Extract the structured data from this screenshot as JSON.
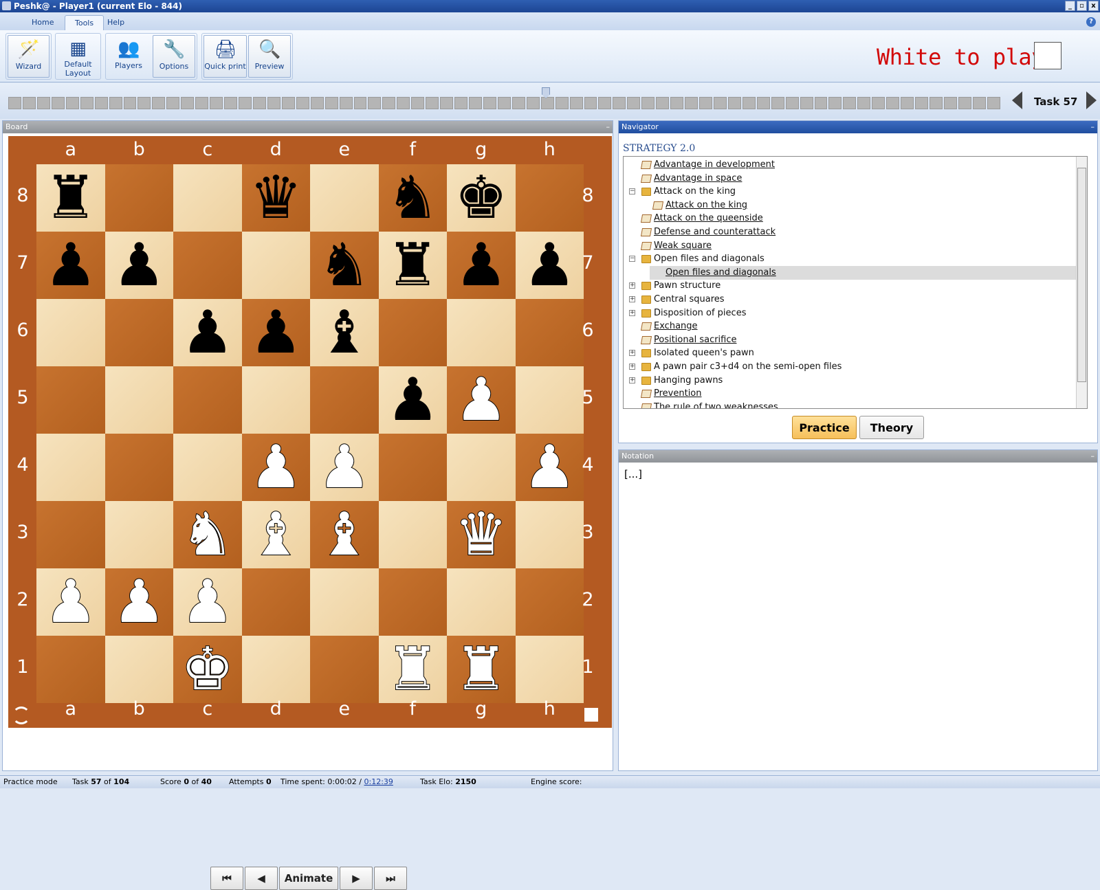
{
  "window": {
    "title": "Peshk@ - Player1 (current Elo - 844)",
    "min": "_",
    "max": "▫",
    "close": "x"
  },
  "ribbon": {
    "tabs": [
      "Home",
      "Tools",
      "Help"
    ],
    "active_tab": "Tools",
    "buttons": [
      {
        "label": "Wizard",
        "icon": "wand-icon"
      },
      {
        "label": "Default Layout",
        "icon": "chessboard-icon"
      },
      {
        "label": "Players",
        "icon": "players-icon"
      },
      {
        "label": "Options",
        "icon": "tools-icon"
      },
      {
        "label": "Quick print",
        "icon": "printer-icon"
      },
      {
        "label": "Preview",
        "icon": "magnifier-icon"
      }
    ],
    "help": "?"
  },
  "prompt": "White to play",
  "task": {
    "label": "Task 57",
    "current": 57,
    "total": 104
  },
  "board_panel": {
    "title": "Board",
    "min": "–"
  },
  "board": {
    "files": [
      "a",
      "b",
      "c",
      "d",
      "e",
      "f",
      "g",
      "h"
    ],
    "ranks": [
      "8",
      "7",
      "6",
      "5",
      "4",
      "3",
      "2",
      "1"
    ],
    "pieces": {
      "a8": "bR",
      "d8": "bQ",
      "f8": "bN",
      "g8": "bK",
      "a7": "bP",
      "b7": "bP",
      "e7": "bN",
      "f7": "bR",
      "g7": "bP",
      "h7": "bP",
      "c6": "bP",
      "d6": "bP",
      "e6": "bB",
      "f5": "bP",
      "g5": "wP",
      "d4": "wP",
      "e4": "wP",
      "h4": "wP",
      "c3": "wN",
      "d3": "wB",
      "e3": "wB",
      "g3": "wQ",
      "a2": "wP",
      "b2": "wP",
      "c2": "wP",
      "c1": "wK",
      "f1": "wR",
      "g1": "wR"
    }
  },
  "move_buttons": {
    "first": "⏮",
    "prev": "◀",
    "animate": "Animate",
    "next": "▶",
    "last": "⏭"
  },
  "navigator": {
    "title": "Navigator",
    "collection": "STRATEGY 2.0",
    "items": [
      {
        "label": "Advantage in development",
        "kind": "task",
        "level": 0,
        "link": true
      },
      {
        "label": "Advantage in space",
        "kind": "task",
        "level": 0,
        "link": true
      },
      {
        "label": "Attack on the king",
        "kind": "folder",
        "level": 0,
        "expander": "−"
      },
      {
        "label": "Attack on the king",
        "kind": "task",
        "level": 1,
        "link": true
      },
      {
        "label": "Attack on the queenside",
        "kind": "task",
        "level": 0,
        "link": true
      },
      {
        "label": "Defense and counterattack",
        "kind": "task",
        "level": 0,
        "link": true
      },
      {
        "label": "Weak square",
        "kind": "task",
        "level": 0,
        "link": true
      },
      {
        "label": "Open files and diagonals",
        "kind": "folder",
        "level": 0,
        "expander": "−"
      },
      {
        "label": "Open files and diagonals",
        "kind": "task",
        "level": 1,
        "link": true,
        "selected": true
      },
      {
        "label": "Pawn structure",
        "kind": "folder",
        "level": 0,
        "expander": "+"
      },
      {
        "label": "Central squares",
        "kind": "folder",
        "level": 0,
        "expander": "+"
      },
      {
        "label": "Disposition of pieces",
        "kind": "folder",
        "level": 0,
        "expander": "+"
      },
      {
        "label": "Exchange",
        "kind": "task",
        "level": 0,
        "link": true
      },
      {
        "label": "Positional sacrifice",
        "kind": "task",
        "level": 0,
        "link": true
      },
      {
        "label": "Isolated queen's pawn",
        "kind": "folder",
        "level": 0,
        "expander": "+"
      },
      {
        "label": "A pawn pair c3+d4 on the semi-open files",
        "kind": "folder",
        "level": 0,
        "expander": "+"
      },
      {
        "label": "Hanging pawns",
        "kind": "folder",
        "level": 0,
        "expander": "+"
      },
      {
        "label": "Prevention",
        "kind": "task",
        "level": 0,
        "link": true
      },
      {
        "label": "The rule of two weaknesses",
        "kind": "task",
        "level": 0,
        "link": true
      }
    ],
    "practice": "Practice",
    "theory": "Theory"
  },
  "notation": {
    "title": "Notation",
    "text": "[...]"
  },
  "status": {
    "mode": "Practice mode",
    "task_prefix": "Task ",
    "task_num": "57",
    "task_of": " of ",
    "task_total": "104",
    "score_prefix": "Score ",
    "score": "0",
    "score_of": " of ",
    "score_total": "40",
    "attempts_prefix": "Attempts ",
    "attempts": "0",
    "time_prefix": "Time spent: ",
    "time": "0:00:02",
    "time_sep": " / ",
    "time_total": "0:12:39",
    "elo_prefix": "Task Elo: ",
    "elo": "2150",
    "engine": "Engine score:"
  },
  "colors": {
    "light_square": "#f2dbb0",
    "dark_square": "#bd6a28",
    "frame": "#b45a22",
    "prompt": "#d20a0a"
  }
}
